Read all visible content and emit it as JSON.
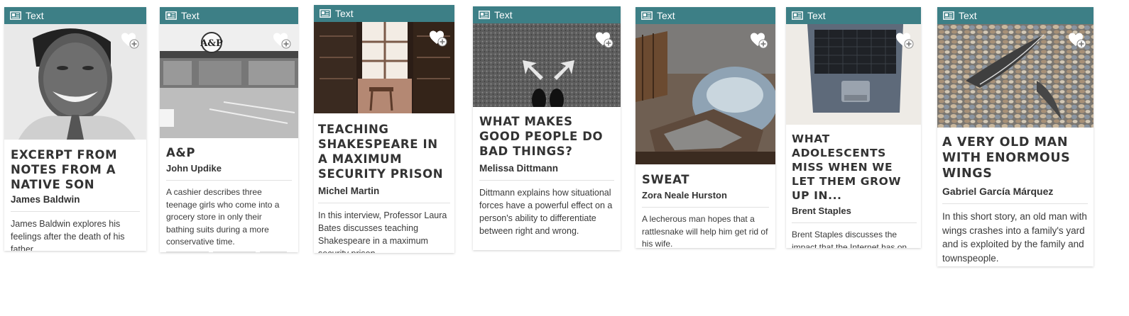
{
  "colors": {
    "header": "#3d7f86",
    "header_text": "#ffffff"
  },
  "type_icon": "text-document-icon",
  "favorite_icon": "heart-plus-icon",
  "cards": [
    {
      "type_label": "Text",
      "title": "Excerpt from Notes from a Native Son",
      "author": "James Baldwin",
      "description": "James Baldwin explores his feelings after the death of his father.",
      "image": "portrait-smiling-man"
    },
    {
      "type_label": "Text",
      "title": "A&P",
      "author": "John Updike",
      "description": "A cashier describes three teenage girls who come into a grocery store in only their bathing suits during a more conservative time.",
      "image": "grocery-store-storefront",
      "storefront_sign": "A&P"
    },
    {
      "type_label": "Text",
      "title": "Teaching Shakespeare in a Maximum Security Prison",
      "author": "Michel Martin",
      "description": "In this interview, Professor Laura Bates discusses teaching Shakespeare in a maximum security prison.",
      "image": "library-bookshelves-window"
    },
    {
      "type_label": "Text",
      "title": "What Makes Good People Do Bad Things?",
      "author": "Melissa Dittmann",
      "description": "Dittmann explains how situational forces have a powerful effect on a person's ability to differentiate between right and wrong.",
      "image": "feet-at-diverging-arrows"
    },
    {
      "type_label": "Text",
      "title": "Sweat",
      "author": "Zora Neale Hurston",
      "description": "A lecherous man hopes that a rattlesnake will help him get rid of his wife.",
      "image": "wash-tub-with-clothes"
    },
    {
      "type_label": "Text",
      "title": "What Adolescents Miss When We Let Them Grow Up In...",
      "author": "Brent Staples",
      "description": "Brent Staples discusses the impact that the Internet has on teenagers' development.",
      "image": "open-laptop-keyboard"
    },
    {
      "type_label": "Text",
      "title": "A Very Old Man with Enormous Wings",
      "author": "Gabriel García Márquez",
      "description": "In this short story, an old man with wings crashes into a family's yard and is exploited by the family and townspeople.",
      "image": "feathers-on-pebbles"
    }
  ]
}
